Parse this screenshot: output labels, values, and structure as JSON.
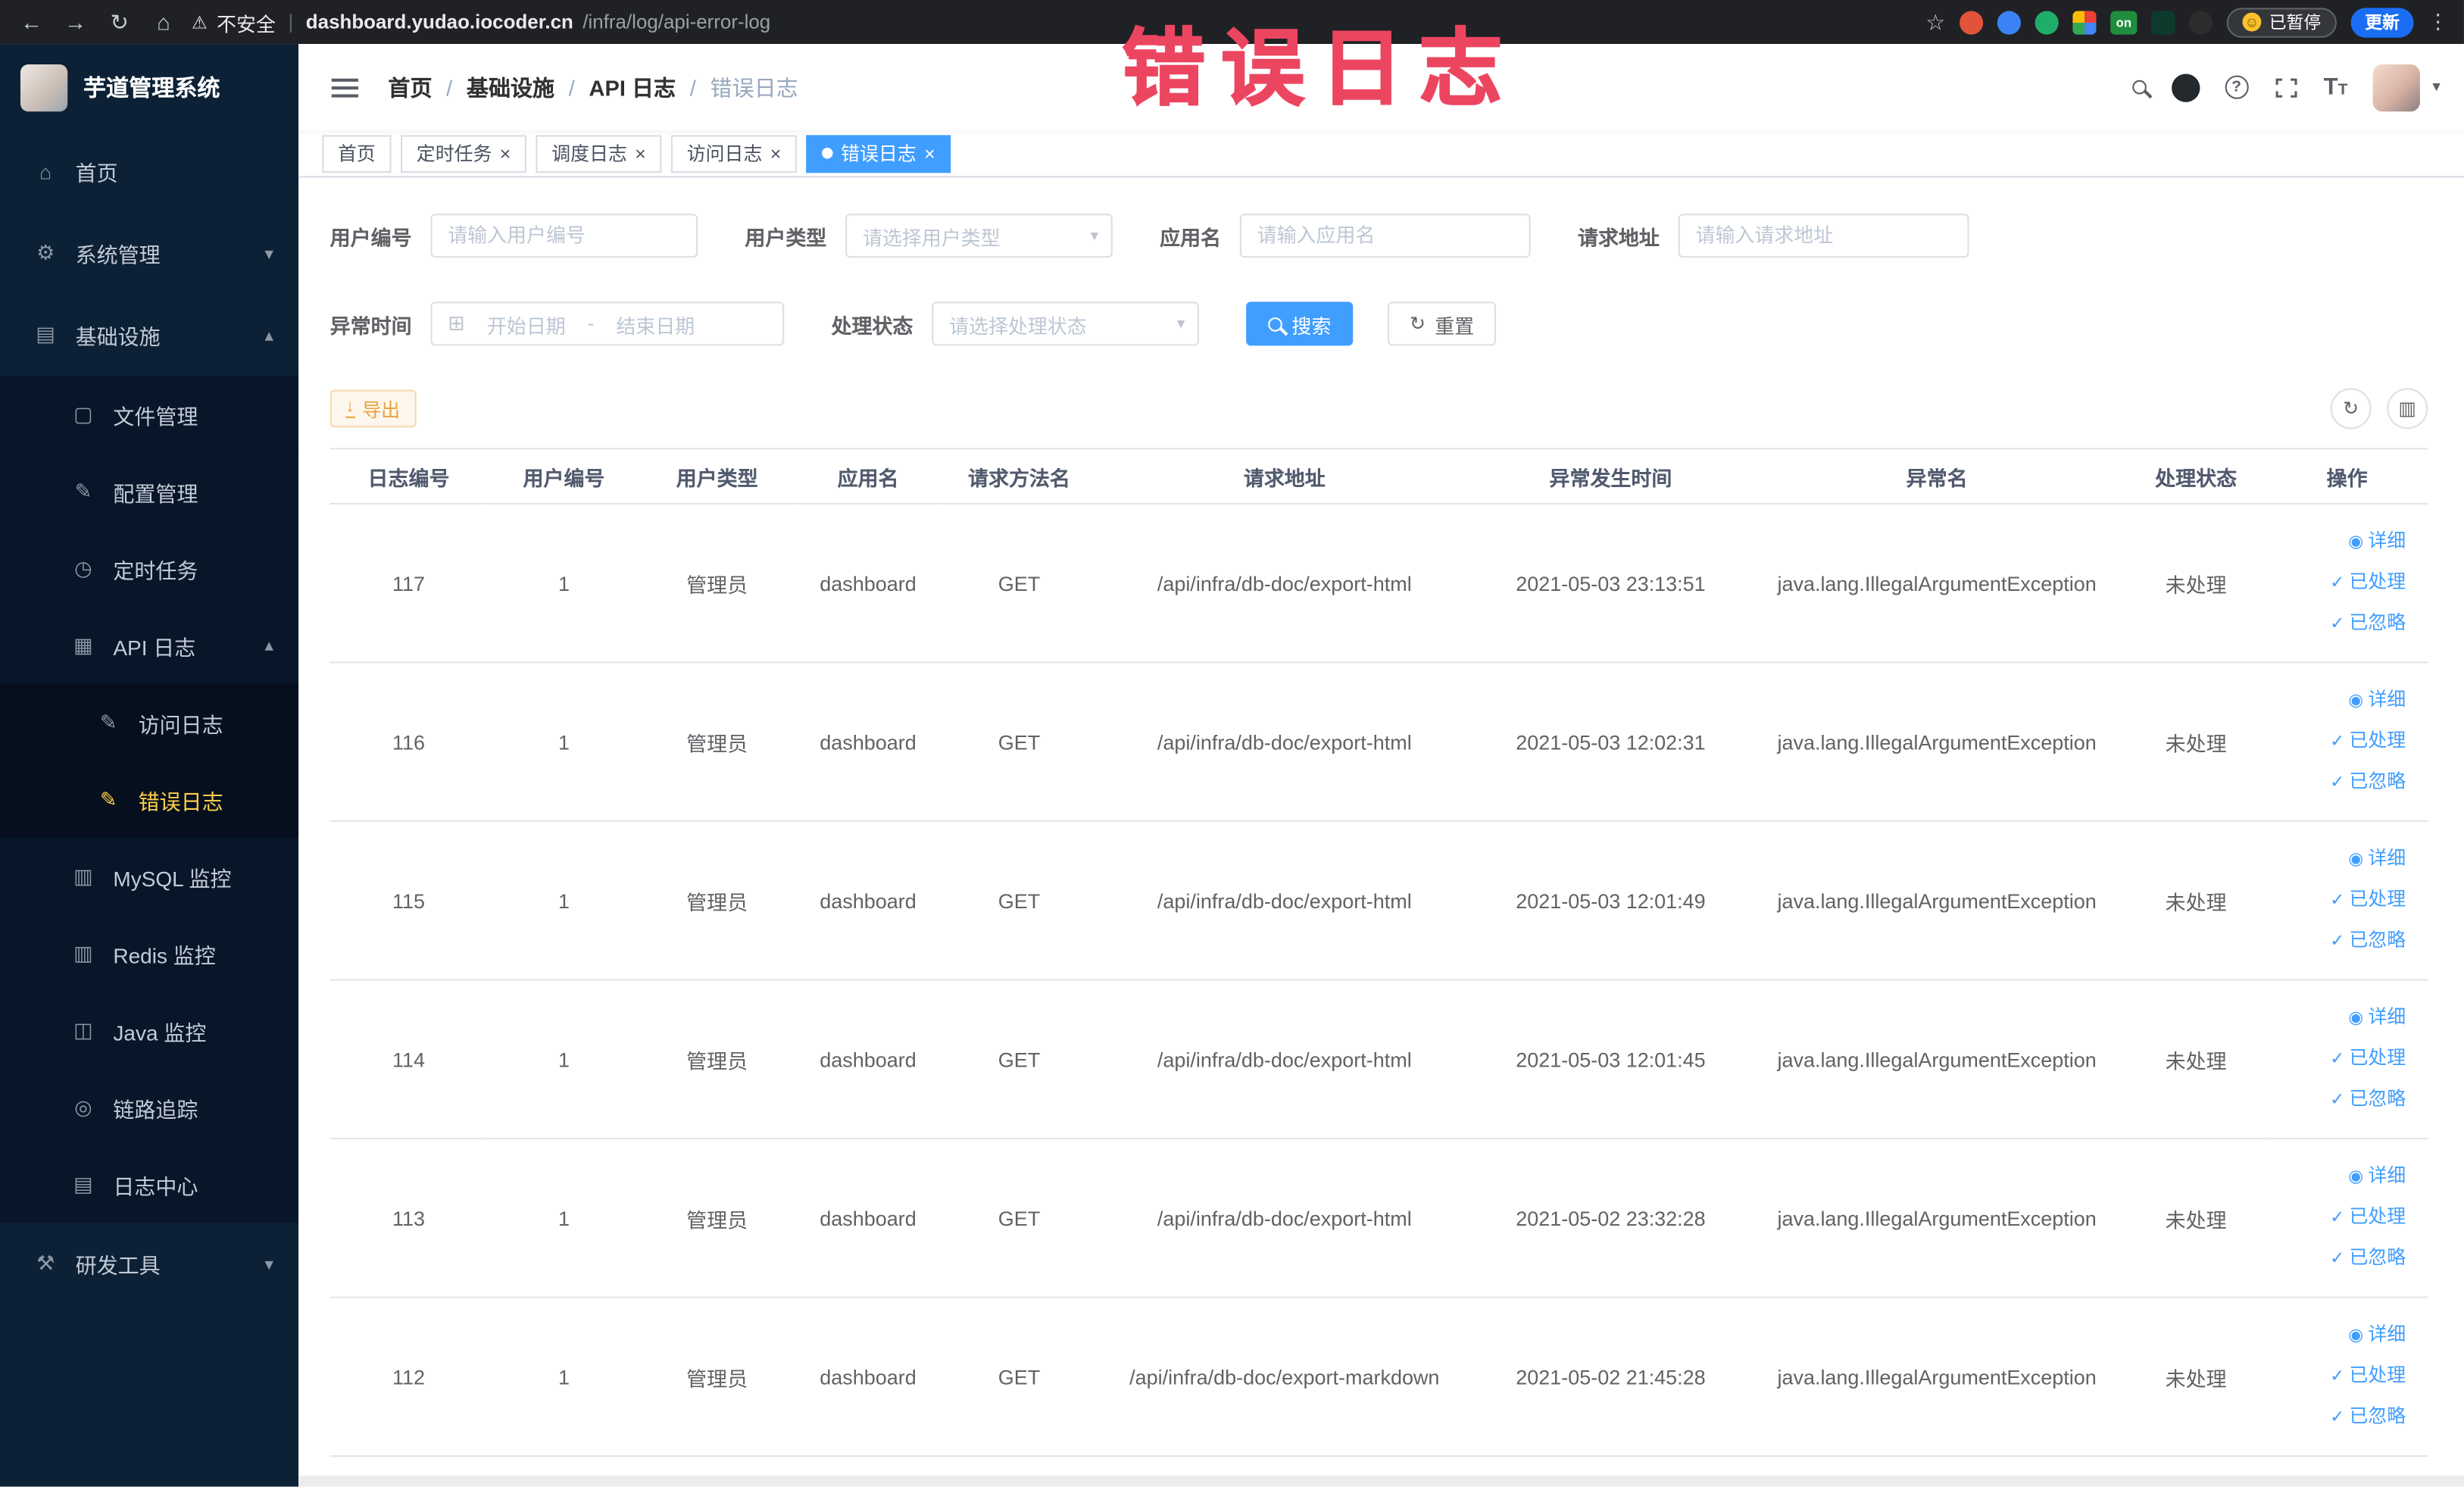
{
  "browser": {
    "security_label": "不安全",
    "url_host": "dashboard.yudao.iocoder.cn",
    "url_path": "/infra/log/api-error-log",
    "on_badge": "on",
    "paused_badge": "已暂停",
    "update_button": "更新"
  },
  "annotation": {
    "text": "错误日志",
    "color": "#ec4560"
  },
  "colors": {
    "accent": "#409eff",
    "warning": "#e6a23c",
    "sidebar_bg": "#0c2135",
    "sidebar_active": "#ffd04b",
    "tab_active_bg": "#409eff"
  },
  "sidebar": {
    "title": "芋道管理系统",
    "items": [
      {
        "label": "首页",
        "icon": "home-icon",
        "glyph": "⌂",
        "level": 1
      },
      {
        "label": "系统管理",
        "icon": "gear-icon",
        "glyph": "⚙",
        "level": 1,
        "arrow": "down"
      },
      {
        "label": "基础设施",
        "icon": "infra-icon",
        "glyph": "▤",
        "level": 1,
        "arrow": "up"
      },
      {
        "label": "文件管理",
        "icon": "file-icon",
        "glyph": "▢",
        "level": 2
      },
      {
        "label": "配置管理",
        "icon": "config-icon",
        "glyph": "✎",
        "level": 2
      },
      {
        "label": "定时任务",
        "icon": "clock-icon",
        "glyph": "◷",
        "level": 2
      },
      {
        "label": "API 日志",
        "icon": "api-log-icon",
        "glyph": "▦",
        "level": 2,
        "arrow": "up"
      },
      {
        "label": "访问日志",
        "icon": "access-log-icon",
        "glyph": "✎",
        "level": 3
      },
      {
        "label": "错误日志",
        "icon": "error-log-icon",
        "glyph": "✎",
        "level": 3,
        "active": true
      },
      {
        "label": "MySQL 监控",
        "icon": "mysql-icon",
        "glyph": "▥",
        "level": 2
      },
      {
        "label": "Redis 监控",
        "icon": "redis-icon",
        "glyph": "▥",
        "level": 2
      },
      {
        "label": "Java 监控",
        "icon": "java-monitor-icon",
        "glyph": "◫",
        "level": 2
      },
      {
        "label": "链路追踪",
        "icon": "trace-icon",
        "glyph": "◎",
        "level": 2
      },
      {
        "label": "日志中心",
        "icon": "log-center-icon",
        "glyph": "▤",
        "level": 2
      },
      {
        "label": "研发工具",
        "icon": "tools-icon",
        "glyph": "⚒",
        "level": 1,
        "arrow": "down"
      }
    ]
  },
  "header": {
    "breadcrumb": [
      "首页",
      "基础设施",
      "API 日志",
      "错误日志"
    ]
  },
  "tabs": [
    {
      "label": "首页",
      "closable": false,
      "active": false
    },
    {
      "label": "定时任务",
      "closable": true,
      "active": false
    },
    {
      "label": "调度日志",
      "closable": true,
      "active": false
    },
    {
      "label": "访问日志",
      "closable": true,
      "active": false
    },
    {
      "label": "错误日志",
      "closable": true,
      "active": true
    }
  ],
  "filters": {
    "user_id": {
      "label": "用户编号",
      "placeholder": "请输入用户编号"
    },
    "user_type": {
      "label": "用户类型",
      "placeholder": "请选择用户类型"
    },
    "app_name": {
      "label": "应用名",
      "placeholder": "请输入应用名"
    },
    "request_url": {
      "label": "请求地址",
      "placeholder": "请输入请求地址"
    },
    "exception_time": {
      "label": "异常时间",
      "start_placeholder": "开始日期",
      "separator": "-",
      "end_placeholder": "结束日期"
    },
    "process_status": {
      "label": "处理状态",
      "placeholder": "请选择处理状态"
    },
    "search_label": "搜索",
    "reset_label": "重置"
  },
  "toolbar": {
    "export_label": "导出"
  },
  "table": {
    "columns": [
      "日志编号",
      "用户编号",
      "用户类型",
      "应用名",
      "请求方法名",
      "请求地址",
      "异常发生时间",
      "异常名",
      "处理状态",
      "操作"
    ],
    "rows": [
      [
        "117",
        "1",
        "管理员",
        "dashboard",
        "GET",
        "/api/infra/db-doc/export-html",
        "2021-05-03 23:13:51",
        "java.lang.IllegalArgumentException",
        "未处理"
      ],
      [
        "116",
        "1",
        "管理员",
        "dashboard",
        "GET",
        "/api/infra/db-doc/export-html",
        "2021-05-03 12:02:31",
        "java.lang.IllegalArgumentException",
        "未处理"
      ],
      [
        "115",
        "1",
        "管理员",
        "dashboard",
        "GET",
        "/api/infra/db-doc/export-html",
        "2021-05-03 12:01:49",
        "java.lang.IllegalArgumentException",
        "未处理"
      ],
      [
        "114",
        "1",
        "管理员",
        "dashboard",
        "GET",
        "/api/infra/db-doc/export-html",
        "2021-05-03 12:01:45",
        "java.lang.IllegalArgumentException",
        "未处理"
      ],
      [
        "113",
        "1",
        "管理员",
        "dashboard",
        "GET",
        "/api/infra/db-doc/export-html",
        "2021-05-02 23:32:28",
        "java.lang.IllegalArgumentException",
        "未处理"
      ],
      [
        "112",
        "1",
        "管理员",
        "dashboard",
        "GET",
        "/api/infra/db-doc/export-markdown",
        "2021-05-02 21:45:28",
        "java.lang.IllegalArgumentException",
        "未处理"
      ]
    ],
    "actions": [
      {
        "name": "detail",
        "label": "详细",
        "icon": "eye-icon",
        "glyph": "◉"
      },
      {
        "name": "processed",
        "label": "已处理",
        "icon": "check-icon",
        "glyph": "✓"
      },
      {
        "name": "ignored",
        "label": "已忽略",
        "icon": "check-icon",
        "glyph": "✓"
      }
    ]
  }
}
